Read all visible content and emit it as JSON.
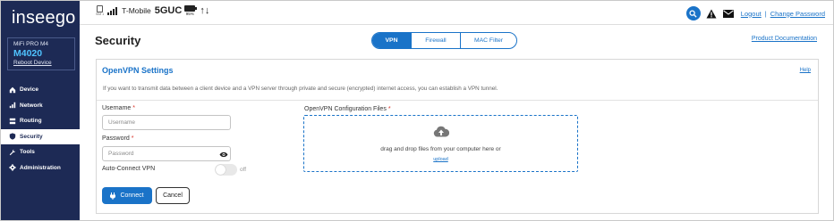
{
  "brand": {
    "logo_a": "insee",
    "logo_b": "go"
  },
  "device": {
    "model": "MiFi PRO M4",
    "name": "M4020",
    "reboot": "Reboot Device"
  },
  "nav": [
    {
      "label": "Device",
      "icon": "home-icon"
    },
    {
      "label": "Network",
      "icon": "signal-icon"
    },
    {
      "label": "Routing",
      "icon": "routing-icon"
    },
    {
      "label": "Security",
      "icon": "shield-icon",
      "active": true
    },
    {
      "label": "Tools",
      "icon": "wrench-icon"
    },
    {
      "label": "Administration",
      "icon": "gear-icon"
    }
  ],
  "status": {
    "sim_label": "SIM 1",
    "carrier": "T-Mobile",
    "network": "5GUC",
    "battery": "95%",
    "data_arrows": "↑↓"
  },
  "top": {
    "logout": "Logout",
    "separator": "|",
    "change_password": "Change Password"
  },
  "header": {
    "title": "Security",
    "tabs": [
      "VPN",
      "Firewall",
      "MAC Filter"
    ],
    "doc_link": "Product Documentation"
  },
  "card": {
    "title": "OpenVPN Settings",
    "help": "Help",
    "description": "If you want to transmit data between a client device and a VPN server through private and secure (encrypted) internet access, you can establish a VPN tunnel.",
    "username_label": "Username",
    "username_placeholder": "Username",
    "password_label": "Password",
    "password_placeholder": "Password",
    "required_mark": "*",
    "auto_connect_label": "Auto-Connect VPN",
    "toggle_state": "off",
    "files_label": "OpenVPN Configuration Files",
    "drop_text": "drag and drop files from your computer here or",
    "upload_link": "upload",
    "connect_button": "Connect",
    "cancel_button": "Cancel"
  },
  "colors": {
    "sidebar": "#1d2a55",
    "accent": "#1a73c8",
    "required": "#d93025"
  }
}
